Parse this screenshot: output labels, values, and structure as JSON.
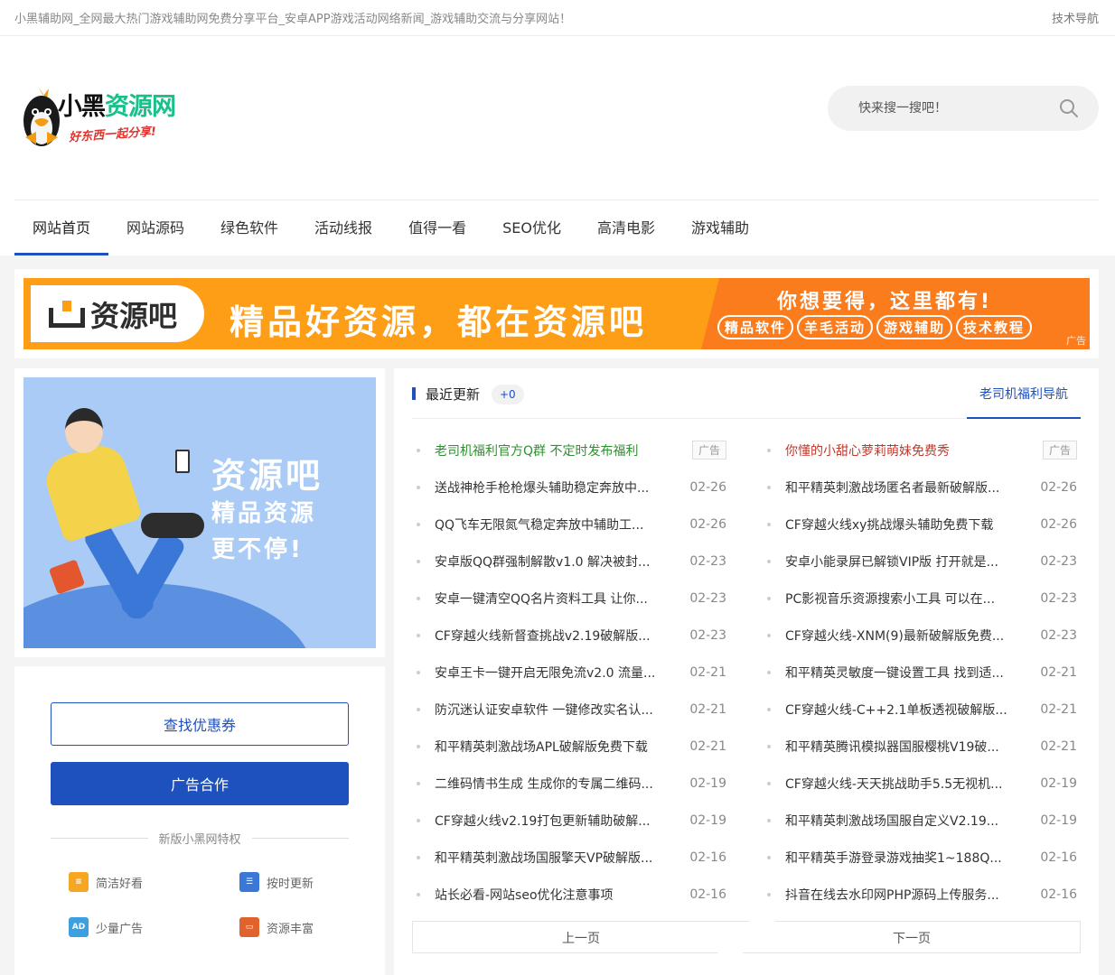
{
  "topbar": {
    "notice": "小黑辅助网_全网最大热门游戏辅助网免费分享平台_安卓APP游戏活动网络新闻_游戏辅助交流与分享网站！",
    "link": "技术导航"
  },
  "logo": {
    "name_black": "小黑",
    "name_green": "资源网",
    "slogan": "好东西一起分享!"
  },
  "search": {
    "placeholder": "快来搜一搜吧！",
    "icon": "search-icon"
  },
  "nav": {
    "items": [
      "网站首页",
      "网站源码",
      "绿色软件",
      "活动线报",
      "值得一看",
      "SEO优化",
      "高清电影",
      "游戏辅助"
    ],
    "active": 0
  },
  "banner": {
    "brand": "资源吧",
    "slogan": "精品好资源，都在资源吧",
    "headline": "你想要得，这里都有!",
    "tags": [
      "精品软件",
      "羊毛活动",
      "游戏辅助",
      "技术教程"
    ],
    "ad_label": "广告"
  },
  "promo": {
    "line1": "资源吧",
    "line2": "精品资源",
    "line3": "更不停!"
  },
  "sidebar": {
    "coupon_button": "查找优惠券",
    "ad_button": "广告合作",
    "features_title": "新版小黑网特权",
    "features": [
      {
        "label": "简洁好看",
        "icon": "chat-icon",
        "color": "#f5a623"
      },
      {
        "label": "按时更新",
        "icon": "document-icon",
        "color": "#3b77d6"
      },
      {
        "label": "少量广告",
        "icon": "ad-icon",
        "color": "#3b9fe0"
      },
      {
        "label": "资源丰富",
        "icon": "laptop-icon",
        "color": "#e0632d"
      }
    ]
  },
  "updates": {
    "title": "最近更新",
    "badge": "+0",
    "tab": "老司机福利导航",
    "left": [
      {
        "title": "老司机福利官方Q群 不定时发布福利",
        "date": "",
        "ad": "广告",
        "style": "green"
      },
      {
        "title": "送战神枪手枪枪爆头辅助稳定奔放中...",
        "date": "02-26"
      },
      {
        "title": "QQ飞车无限氮气稳定奔放中辅助工...",
        "date": "02-26"
      },
      {
        "title": "安卓版QQ群强制解散v1.0 解决被封...",
        "date": "02-23"
      },
      {
        "title": "安卓一键清空QQ名片资料工具 让你...",
        "date": "02-23"
      },
      {
        "title": "CF穿越火线新督查挑战v2.19破解版...",
        "date": "02-23"
      },
      {
        "title": "安卓王卡一键开启无限免流v2.0 流量...",
        "date": "02-21"
      },
      {
        "title": "防沉迷认证安卓软件 一键修改实名认...",
        "date": "02-21"
      },
      {
        "title": "和平精英刺激战场APL破解版免费下载",
        "date": "02-21"
      },
      {
        "title": "二维码情书生成 生成你的专属二维码...",
        "date": "02-19"
      },
      {
        "title": "CF穿越火线v2.19打包更新辅助破解...",
        "date": "02-19"
      },
      {
        "title": "和平精英刺激战场国服擎天VP破解版...",
        "date": "02-16"
      },
      {
        "title": "站长必看-网站seo优化注意事项",
        "date": "02-16"
      }
    ],
    "right": [
      {
        "title": "你懂的小甜心萝莉萌妹免费秀",
        "date": "",
        "ad": "广告",
        "style": "red"
      },
      {
        "title": "和平精英刺激战场匿名者最新破解版...",
        "date": "02-26"
      },
      {
        "title": "CF穿越火线xy挑战爆头辅助免费下载",
        "date": "02-26"
      },
      {
        "title": "安卓小能录屏已解锁VIP版 打开就是...",
        "date": "02-23"
      },
      {
        "title": "PC影视音乐资源搜索小工具 可以在...",
        "date": "02-23"
      },
      {
        "title": "CF穿越火线-XNM(9)最新破解版免费...",
        "date": "02-23"
      },
      {
        "title": "和平精英灵敏度一键设置工具 找到适...",
        "date": "02-21"
      },
      {
        "title": "CF穿越火线-C++2.1单板透视破解版...",
        "date": "02-21"
      },
      {
        "title": "和平精英腾讯模拟器国服樱桃V19破...",
        "date": "02-21"
      },
      {
        "title": "CF穿越火线-天天挑战助手5.5无视机...",
        "date": "02-19"
      },
      {
        "title": "和平精英刺激战场国服自定义V2.19...",
        "date": "02-19"
      },
      {
        "title": "和平精英手游登录游戏抽奖1~188Q...",
        "date": "02-16"
      },
      {
        "title": "抖音在线去水印网PHP源码上传服务...",
        "date": "02-16"
      }
    ],
    "prev": "上一页",
    "next": "下一页"
  }
}
